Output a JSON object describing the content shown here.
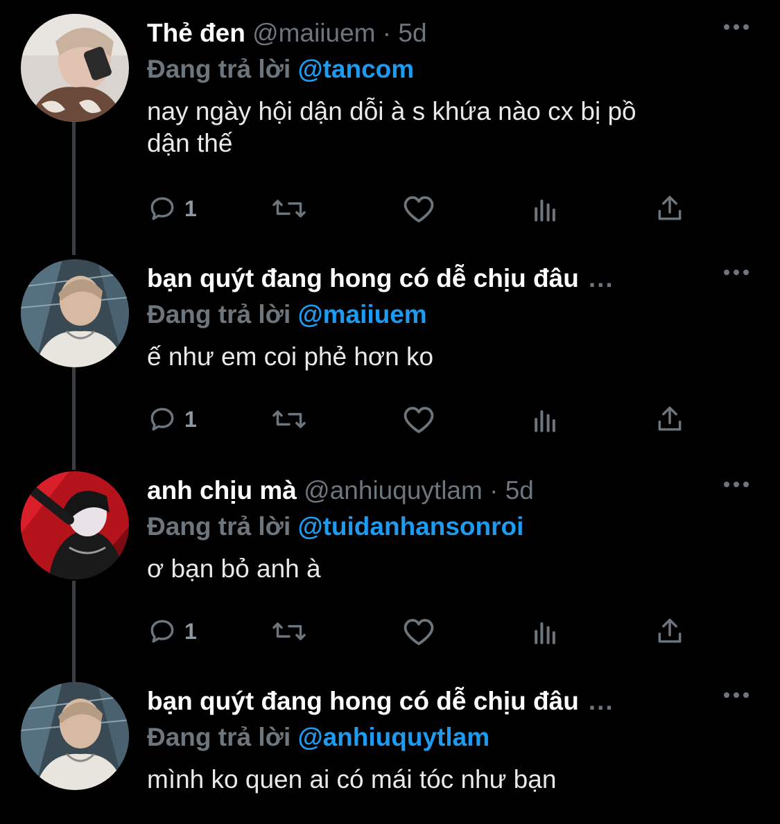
{
  "theme": {
    "background": "#000000",
    "muted": "#6e767d",
    "link": "#1d9bf0",
    "thread_line": "#3a3d42"
  },
  "tweets": [
    {
      "name": "Thẻ đen",
      "handle": "@maiiuem",
      "dot": "·",
      "time": "5d",
      "truncated_marker": "",
      "reply_prefix": "Đang trả lời",
      "reply_to": "@tancom",
      "text_line1": "nay ngày hội dận dỗi à s khứa nào cx bị pồ",
      "text_line2": "dận thế",
      "reply_count": "1",
      "avatar_icon": "avatar-photo"
    },
    {
      "name": "bạn quýt đang hong có dễ chịu đâu",
      "handle": "",
      "dot": "",
      "time": "",
      "truncated_marker": "...",
      "reply_prefix": "Đang trả lời",
      "reply_to": "@maiiuem",
      "text_line1": "ế như em coi phẻ hơn ko",
      "text_line2": "",
      "reply_count": "1",
      "avatar_icon": "avatar-photo"
    },
    {
      "name": "anh chịu mà",
      "handle": "@anhiuquytlam",
      "dot": "·",
      "time": "5d",
      "truncated_marker": "",
      "reply_prefix": "Đang trả lời",
      "reply_to": "@tuidanhansonroi",
      "text_line1": "ơ bạn bỏ anh à",
      "text_line2": "",
      "reply_count": "1",
      "avatar_icon": "avatar-photo"
    },
    {
      "name": "bạn quýt đang hong có dễ chịu đâu",
      "handle": "",
      "dot": "",
      "time": "",
      "truncated_marker": "...",
      "reply_prefix": "Đang trả lời",
      "reply_to": "@anhiuquytlam",
      "text_line1": "mình ko quen ai có mái tóc như bạn",
      "text_line2": "",
      "reply_count": "",
      "avatar_icon": "avatar-photo"
    }
  ]
}
